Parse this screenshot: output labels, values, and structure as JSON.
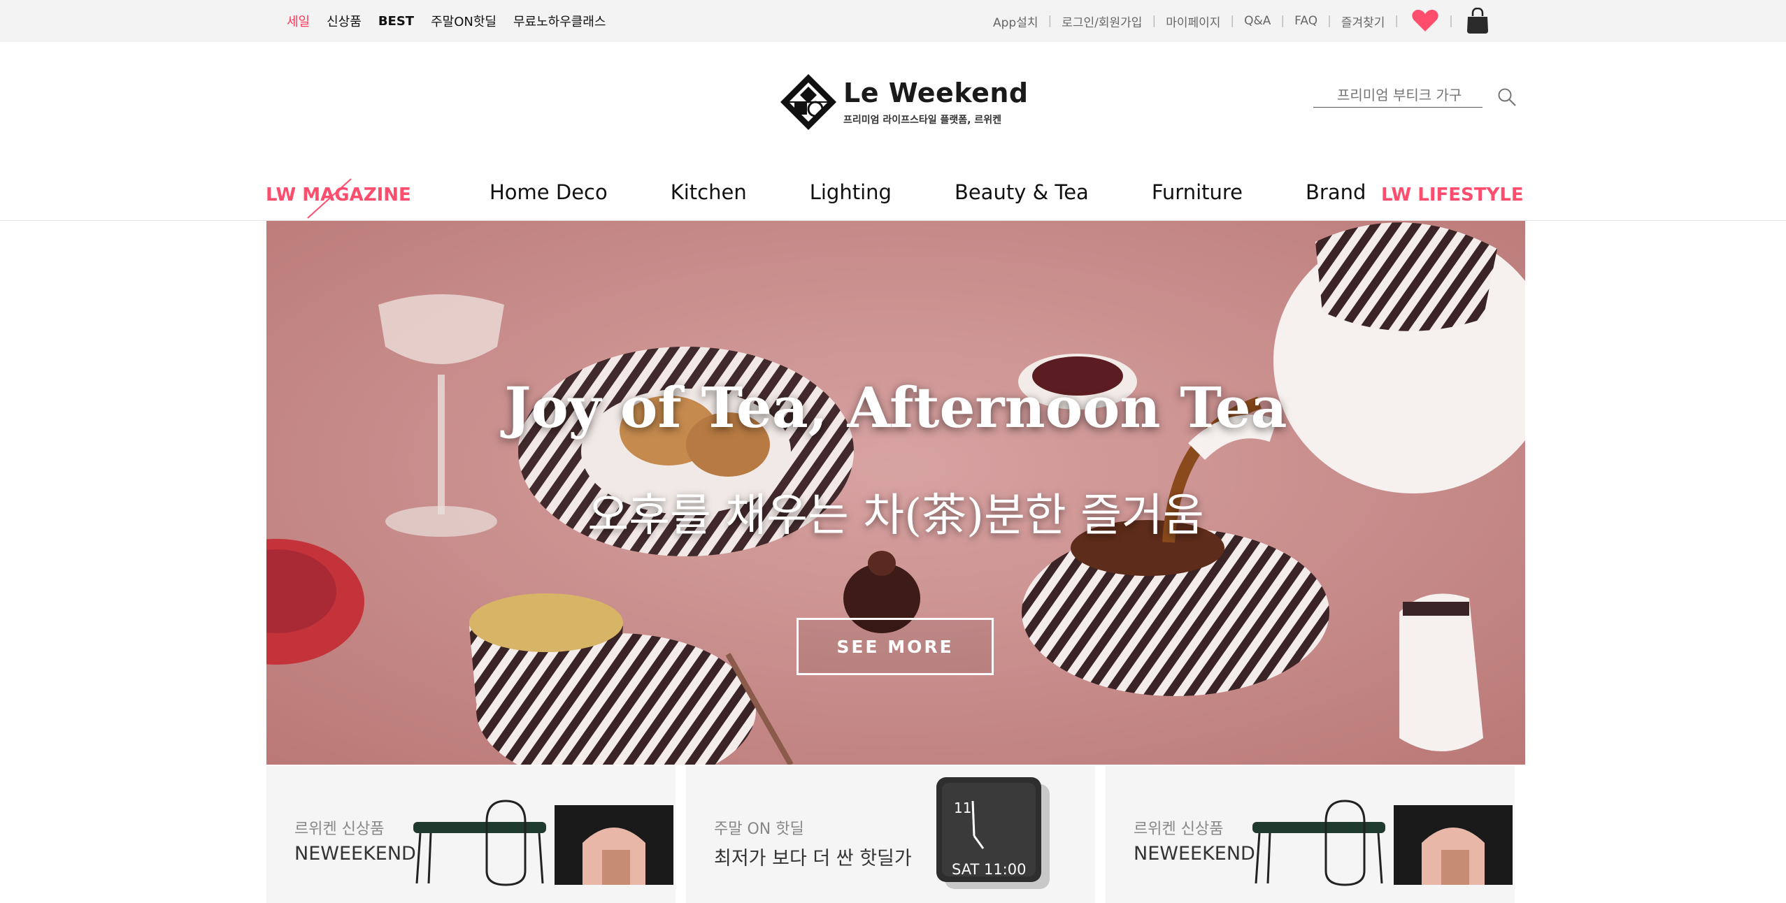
{
  "topbar": {
    "left_links": [
      "세일",
      "신상품",
      "BEST",
      "주말ON핫딜",
      "무료노하우클래스"
    ],
    "right_links": [
      "App설치",
      "로그인/회원가입",
      "마이페이지",
      "Q&A",
      "FAQ",
      "즐겨찾기"
    ],
    "heart_color": "#ff4d6d"
  },
  "header": {
    "logo_title": "Le Weekend",
    "logo_subtitle": "프리미엄 라이프스타일 플랫폼, 르위켄",
    "search_placeholder": "프리미엄 부티크 가구"
  },
  "nav": {
    "magazine": "LW MAGAZINE",
    "items": [
      "Home Deco",
      "Kitchen",
      "Lighting",
      "Beauty & Tea",
      "Furniture",
      "Brand"
    ],
    "lifestyle": "LW LIFESTYLE",
    "accent": "#ff4d6d"
  },
  "hero": {
    "title": "Joy of Tea, Afternoon Tea",
    "subtitle": "오후를 채우는 차(茶)분한 즐거움",
    "button": "SEE MORE",
    "background": "#c98a8a"
  },
  "promos": [
    {
      "caption": "르위켄 신상품",
      "heading": "NEWEEKEND"
    },
    {
      "caption": "주말 ON 핫딜",
      "heading": "최저가 보다 더 싼 핫딜가",
      "clock_hour": "11",
      "clock_label": "SAT 11:00"
    },
    {
      "caption": "르위켄 신상품",
      "heading": "NEWEEKEND"
    }
  ]
}
